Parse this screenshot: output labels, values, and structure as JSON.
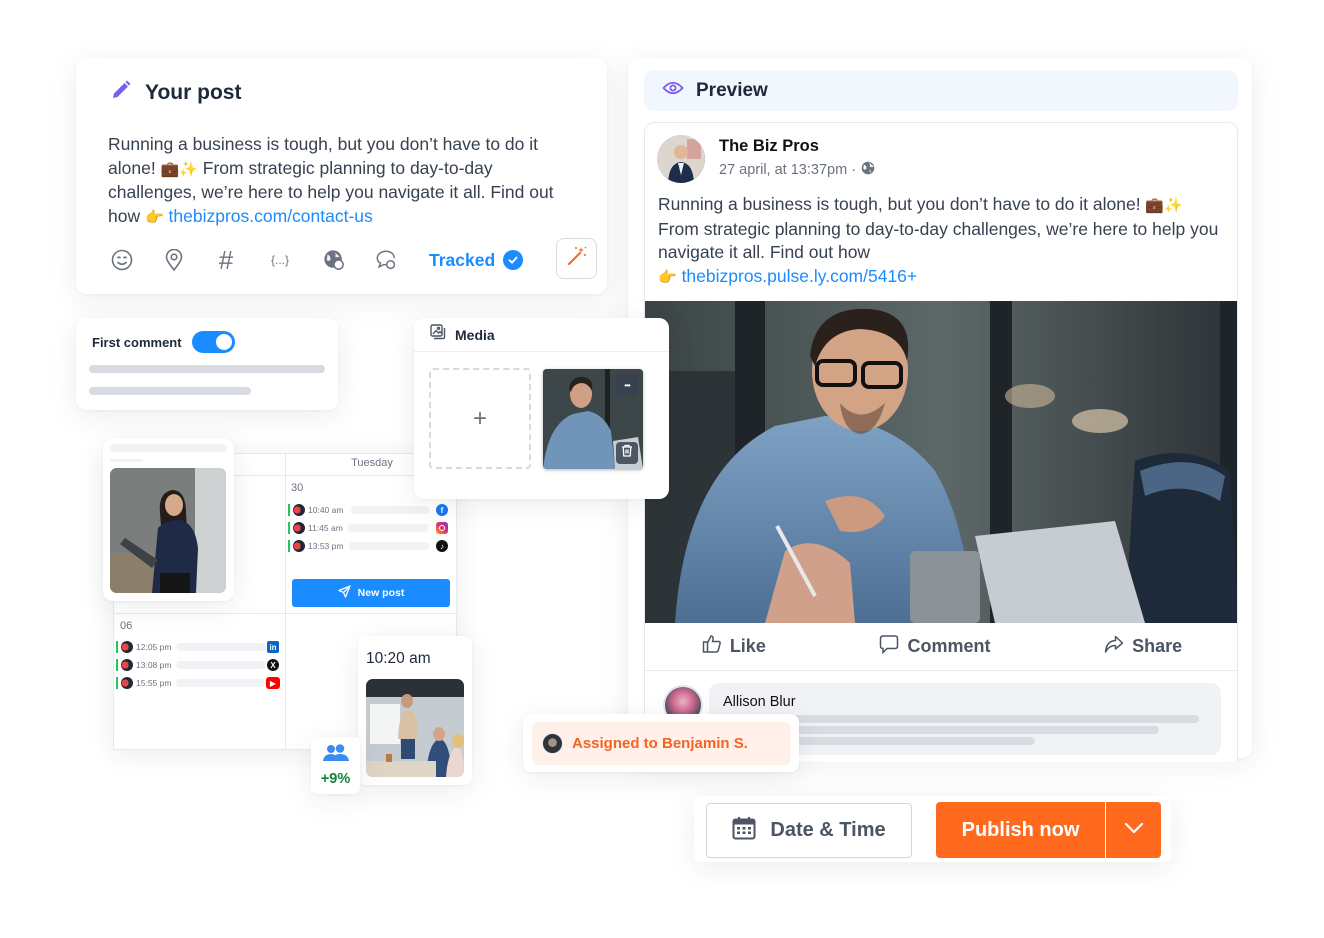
{
  "composer": {
    "title": "Your post",
    "text_part1": "Running a business is tough, but you don’t have to do it alone! ",
    "emoji1": "💼✨",
    "text_part2": " From strategic planning to day-to-day challenges, we’re here to help you navigate it all. Find out how ",
    "emoji2": "👉",
    "link": "thebizpros.com/contact-us",
    "toolbar": {
      "icons": [
        "emoji-icon",
        "location-icon",
        "hashtag-icon",
        "variables-icon",
        "globe-icon",
        "comment-icon"
      ],
      "hashtag_glyph": "#",
      "variables_glyph": "{...}",
      "tracked_label": "Tracked",
      "tracked_state": true
    }
  },
  "preview": {
    "title": "Preview",
    "post": {
      "page_name": "The Biz Pros",
      "timestamp": "27 april, at 13:37pm ·",
      "text_part1": "Running a business is tough, but you don’t have to do it alone! ",
      "emoji1": "💼✨",
      "text_part2": " From strategic planning to day-to-day challenges, we’re here to help you navigate it all. Find out how",
      "emoji2": "👉",
      "link": "thebizpros.pulse.ly.com/5416+",
      "actions": [
        "Like",
        "Comment",
        "Share"
      ],
      "comment_author": "Allison Blur"
    }
  },
  "first_comment": {
    "label": "First comment",
    "enabled": true
  },
  "media": {
    "title": "Media",
    "add_glyph": "+",
    "thumb_menu_glyph": "•••"
  },
  "calendar": {
    "day_name": "Tuesday",
    "cells": [
      {
        "date": "30",
        "events": [
          {
            "time": "10:40 am",
            "network": "facebook"
          },
          {
            "time": "11:45 am",
            "network": "instagram"
          },
          {
            "time": "13:53 pm",
            "network": "tiktok"
          }
        ]
      },
      {
        "date": "06",
        "events": [
          {
            "time": "12:05 pm",
            "network": "linkedin"
          },
          {
            "time": "13:08 pm",
            "network": "x"
          },
          {
            "time": "15:55 pm",
            "network": "youtube"
          }
        ]
      }
    ],
    "new_post_label": "New post"
  },
  "scheduled_card": {
    "time": "10:20 am"
  },
  "growth": {
    "value": "+9%"
  },
  "assignment": {
    "label": "Assigned to Benjamin S."
  },
  "actions": {
    "date_time_label": "Date & Time",
    "publish_label": "Publish now"
  },
  "colors": {
    "accent_blue": "#1a8cff",
    "publish_orange": "#ff6a1f",
    "assigned_text": "#f26522",
    "assigned_bg": "#fff0ea",
    "growth_green": "#15803d",
    "icon_purple": "#7b5cf0"
  }
}
